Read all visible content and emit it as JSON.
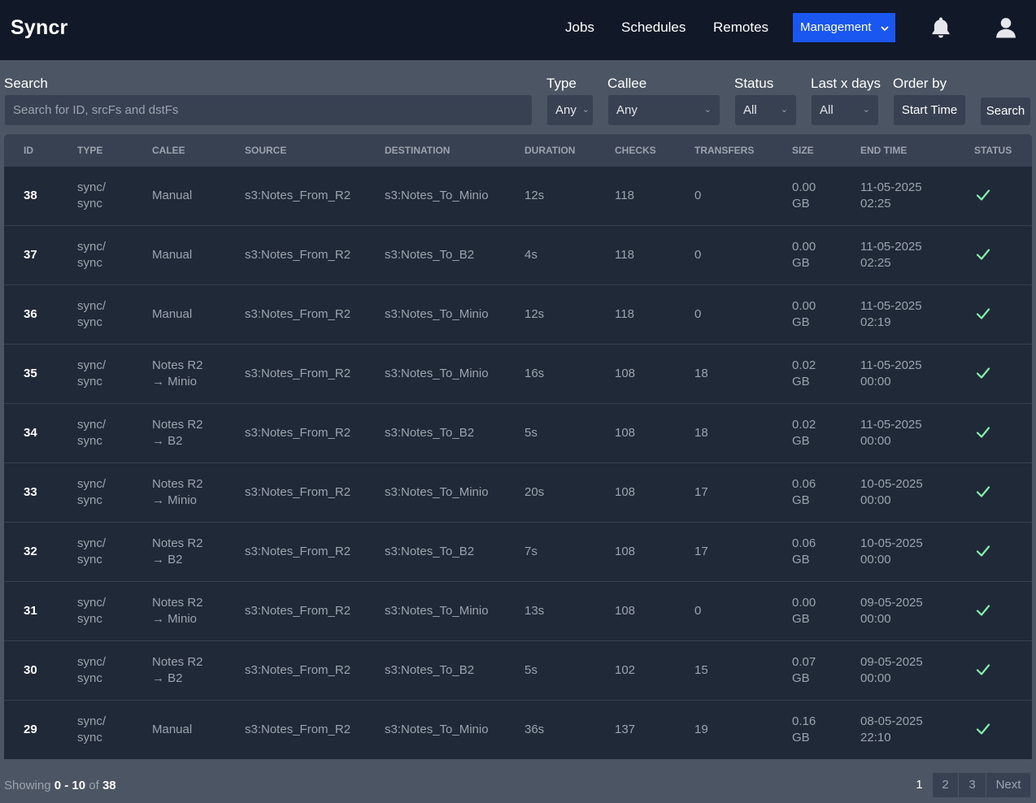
{
  "app": {
    "brand": "Syncr"
  },
  "nav": {
    "links": [
      "Jobs",
      "Schedules",
      "Remotes"
    ],
    "management_label": "Management"
  },
  "filters": {
    "search_label": "Search",
    "search_placeholder": "Search for ID, srcFs and dstFs",
    "type_label": "Type",
    "type_value": "Any",
    "callee_label": "Callee",
    "callee_value": "Any",
    "status_label": "Status",
    "status_value": "All",
    "days_label": "Last x days",
    "days_value": "All",
    "order_label": "Order by",
    "order_value": "Start Time",
    "search_button": "Search"
  },
  "table": {
    "headers": [
      "ID",
      "TYPE",
      "CALEE",
      "SOURCE",
      "DESTINATION",
      "DURATION",
      "CHECKS",
      "TRANSFERS",
      "SIZE",
      "END TIME",
      "STATUS"
    ],
    "rows": [
      {
        "id": "38",
        "type1": "sync/",
        "type2": "sync",
        "callee1": "Manual",
        "callee2": "",
        "source": "s3:Notes_From_R2",
        "dest": "s3:Notes_To_Minio",
        "duration": "12s",
        "checks": "118",
        "transfers": "0",
        "size1": "0.00",
        "size2": "GB",
        "end1": "11-05-2025",
        "end2": "02:25",
        "status": "success"
      },
      {
        "id": "37",
        "type1": "sync/",
        "type2": "sync",
        "callee1": "Manual",
        "callee2": "",
        "source": "s3:Notes_From_R2",
        "dest": "s3:Notes_To_B2",
        "duration": "4s",
        "checks": "118",
        "transfers": "0",
        "size1": "0.00",
        "size2": "GB",
        "end1": "11-05-2025",
        "end2": "02:25",
        "status": "success"
      },
      {
        "id": "36",
        "type1": "sync/",
        "type2": "sync",
        "callee1": "Manual",
        "callee2": "",
        "source": "s3:Notes_From_R2",
        "dest": "s3:Notes_To_Minio",
        "duration": "12s",
        "checks": "118",
        "transfers": "0",
        "size1": "0.00",
        "size2": "GB",
        "end1": "11-05-2025",
        "end2": "02:19",
        "status": "success"
      },
      {
        "id": "35",
        "type1": "sync/",
        "type2": "sync",
        "callee1": "Notes R2",
        "callee2": "→ Minio",
        "source": "s3:Notes_From_R2",
        "dest": "s3:Notes_To_Minio",
        "duration": "16s",
        "checks": "108",
        "transfers": "18",
        "size1": "0.02",
        "size2": "GB",
        "end1": "11-05-2025",
        "end2": "00:00",
        "status": "success"
      },
      {
        "id": "34",
        "type1": "sync/",
        "type2": "sync",
        "callee1": "Notes R2",
        "callee2": "→ B2",
        "source": "s3:Notes_From_R2",
        "dest": "s3:Notes_To_B2",
        "duration": "5s",
        "checks": "108",
        "transfers": "18",
        "size1": "0.02",
        "size2": "GB",
        "end1": "11-05-2025",
        "end2": "00:00",
        "status": "success"
      },
      {
        "id": "33",
        "type1": "sync/",
        "type2": "sync",
        "callee1": "Notes R2",
        "callee2": "→ Minio",
        "source": "s3:Notes_From_R2",
        "dest": "s3:Notes_To_Minio",
        "duration": "20s",
        "checks": "108",
        "transfers": "17",
        "size1": "0.06",
        "size2": "GB",
        "end1": "10-05-2025",
        "end2": "00:00",
        "status": "success"
      },
      {
        "id": "32",
        "type1": "sync/",
        "type2": "sync",
        "callee1": "Notes R2",
        "callee2": "→ B2",
        "source": "s3:Notes_From_R2",
        "dest": "s3:Notes_To_B2",
        "duration": "7s",
        "checks": "108",
        "transfers": "17",
        "size1": "0.06",
        "size2": "GB",
        "end1": "10-05-2025",
        "end2": "00:00",
        "status": "success"
      },
      {
        "id": "31",
        "type1": "sync/",
        "type2": "sync",
        "callee1": "Notes R2",
        "callee2": "→ Minio",
        "source": "s3:Notes_From_R2",
        "dest": "s3:Notes_To_Minio",
        "duration": "13s",
        "checks": "108",
        "transfers": "0",
        "size1": "0.00",
        "size2": "GB",
        "end1": "09-05-2025",
        "end2": "00:00",
        "status": "success"
      },
      {
        "id": "30",
        "type1": "sync/",
        "type2": "sync",
        "callee1": "Notes R2",
        "callee2": "→ B2",
        "source": "s3:Notes_From_R2",
        "dest": "s3:Notes_To_B2",
        "duration": "5s",
        "checks": "102",
        "transfers": "15",
        "size1": "0.07",
        "size2": "GB",
        "end1": "09-05-2025",
        "end2": "00:00",
        "status": "success"
      },
      {
        "id": "29",
        "type1": "sync/",
        "type2": "sync",
        "callee1": "Manual",
        "callee2": "",
        "source": "s3:Notes_From_R2",
        "dest": "s3:Notes_To_Minio",
        "duration": "36s",
        "checks": "137",
        "transfers": "19",
        "size1": "0.16",
        "size2": "GB",
        "end1": "08-05-2025",
        "end2": "22:10",
        "status": "success"
      }
    ]
  },
  "footer": {
    "showing_prefix": "Showing",
    "range": "0 - 10",
    "of_label": "of",
    "total": "38",
    "pages": [
      "1",
      "2",
      "3"
    ],
    "next_label": "Next"
  },
  "colors": {
    "accent": "#1a56f0",
    "success": "#86efac",
    "navbar": "#111827",
    "table_bg": "#1f2937"
  },
  "icons": {
    "notifications": "bell-icon",
    "user": "user-icon",
    "status_success": "check-icon"
  }
}
